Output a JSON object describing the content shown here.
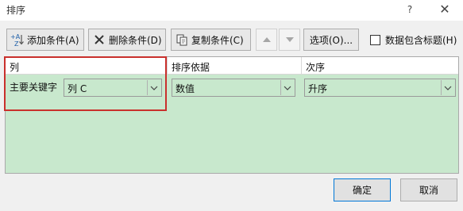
{
  "dialog": {
    "title": "排序",
    "help": "?",
    "close": "✕"
  },
  "toolbar": {
    "add_condition": "添加条件(A)",
    "delete_condition": "删除条件(D)",
    "copy_condition": "复制条件(C)",
    "options": "选项(O)...",
    "header_checkbox_label": "数据包含标题(H)"
  },
  "grid": {
    "headers": {
      "column": "列",
      "sort_on": "排序依据",
      "order": "次序"
    },
    "row": {
      "label": "主要关键字",
      "column_value": "列 C",
      "sort_on_value": "数值",
      "order_value": "升序"
    }
  },
  "buttons": {
    "ok": "确定",
    "cancel": "取消"
  },
  "colors": {
    "grid_bg": "#c8e8cd",
    "highlight": "#c9302c"
  },
  "icons": {
    "add": "add-condition-icon",
    "delete": "delete-x-icon",
    "copy": "copy-icon",
    "up": "move-up-icon",
    "down": "move-down-icon",
    "chevron": "chevron-down-icon"
  }
}
